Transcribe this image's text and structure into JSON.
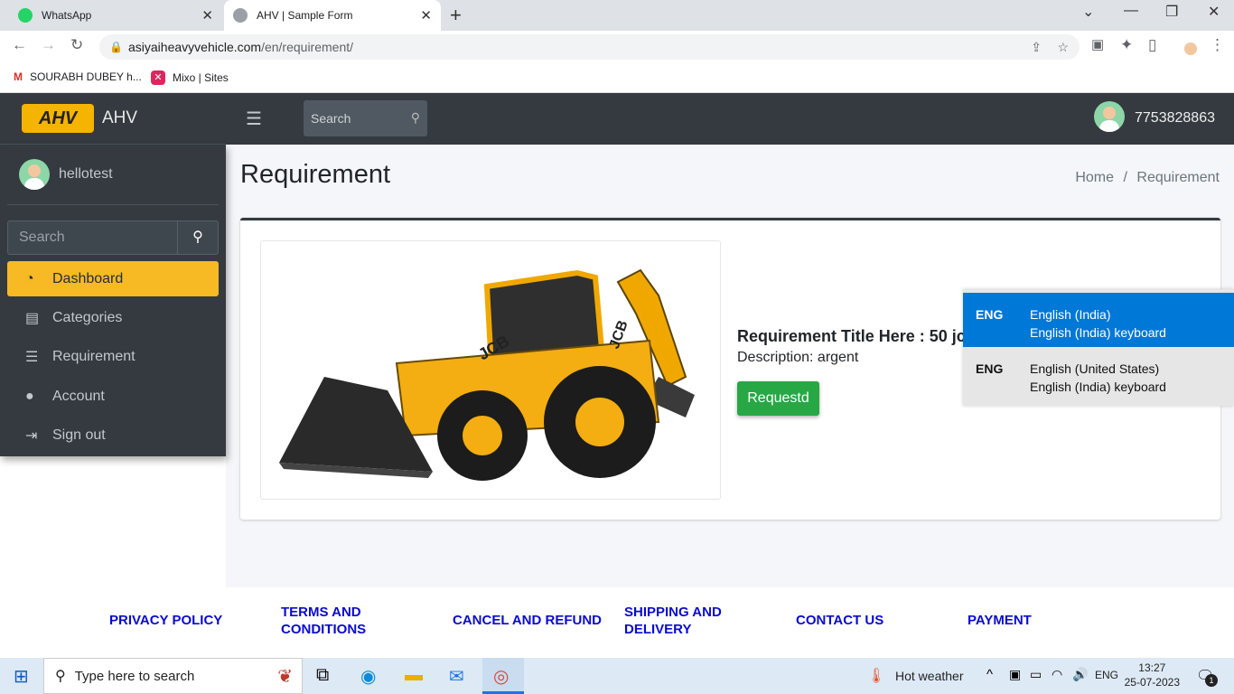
{
  "browser": {
    "tabs": [
      {
        "title": "WhatsApp",
        "icon": "whatsapp-icon"
      },
      {
        "title": "AHV | Sample Form",
        "icon": "globe-icon"
      }
    ],
    "new_tab": "+",
    "url_host": "asiyaiheavyvehicle.com",
    "url_path": "/en/requirement/",
    "bookmarks": [
      {
        "label": "SOURABH DUBEY h...",
        "icon": "gmail-icon"
      },
      {
        "label": "Mixo | Sites",
        "icon": "mixo-icon"
      }
    ]
  },
  "header": {
    "brand": "AHV",
    "logo_text": "AHV",
    "search_placeholder": "Search",
    "phone": "7753828863"
  },
  "sidebar": {
    "username": "hellotest",
    "search_placeholder": "Search",
    "items": [
      {
        "label": "Dashboard",
        "icon": "dashboard-icon",
        "active": true
      },
      {
        "label": "Categories",
        "icon": "clipboard-icon",
        "active": false
      },
      {
        "label": "Requirement",
        "icon": "list-icon",
        "active": false
      },
      {
        "label": "Account",
        "icon": "user-circle-icon",
        "active": false
      },
      {
        "label": "Sign out",
        "icon": "sign-out-icon",
        "active": false
      }
    ]
  },
  "main": {
    "title": "Requirement",
    "breadcrumb": {
      "home": "Home",
      "sep": "/",
      "current": "Requirement"
    },
    "card": {
      "req_title": "Requirement Title Here : 50 jcb",
      "description": "Description: argent",
      "button": "Requestd"
    }
  },
  "language_popup": {
    "options": [
      {
        "code": "ENG",
        "language": "English (India)",
        "keyboard": "English (India) keyboard",
        "selected": true
      },
      {
        "code": "ENG",
        "language": "English (United States)",
        "keyboard": "English (India) keyboard",
        "selected": false
      }
    ]
  },
  "footer": {
    "links": [
      "PRIVACY POLICY",
      "TERMS AND CONDITIONS",
      "CANCEL AND REFUND",
      "SHIPPING AND DELIVERY",
      "CONTACT US",
      "PAYMENT"
    ],
    "link_color": "#0a0ad0"
  },
  "taskbar": {
    "search_placeholder": "Type here to search",
    "weather": "Hot weather",
    "lang": "ENG",
    "time": "13:27",
    "date": "25-07-2023",
    "notifications": "1"
  },
  "colors": {
    "accent": "#f7b924",
    "success": "#28a745",
    "dark": "#343a40",
    "selection": "#0078d7"
  }
}
